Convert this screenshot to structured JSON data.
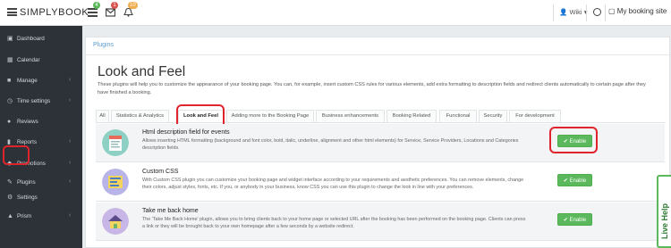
{
  "brand": "SIMPLYBOOK",
  "topbar": {
    "badges": [
      "4",
      "1",
      "10"
    ],
    "user": "Wiki",
    "booking_site": "My booking site"
  },
  "sidebar": {
    "items": [
      {
        "label": "Dashboard",
        "icon": "dashboard-icon",
        "arrow": ""
      },
      {
        "label": "Calendar",
        "icon": "calendar-icon",
        "arrow": ""
      },
      {
        "label": "Manage",
        "icon": "manage-icon",
        "arrow": "‹"
      },
      {
        "label": "Time settings",
        "icon": "clock-icon",
        "arrow": "‹"
      },
      {
        "label": "Reviews",
        "icon": "reviews-icon",
        "arrow": ""
      },
      {
        "label": "Reports",
        "icon": "reports-icon",
        "arrow": "‹"
      },
      {
        "label": "Promotions",
        "icon": "promotions-icon",
        "arrow": "‹"
      },
      {
        "label": "Plugins",
        "icon": "plugins-icon",
        "arrow": "‹"
      },
      {
        "label": "Settings",
        "icon": "settings-icon",
        "arrow": ""
      },
      {
        "label": "Prism",
        "icon": "prism-icon",
        "arrow": "‹"
      }
    ]
  },
  "main": {
    "breadcrumb": "Plugins",
    "title": "Look and Feel",
    "description": "These plugins will help you to customize the appearance of your booking page. You can, for example, insert custom CSS rules for various elements, add extra formatting to description fields and redirect clients automatically to certain page after they have finished a booking.",
    "tabs": [
      {
        "label": "All"
      },
      {
        "label": "Statistics & Analytics"
      },
      {
        "label": "Look and Feel"
      },
      {
        "label": "Adding more to the Booking Page"
      },
      {
        "label": "Business enhancements"
      },
      {
        "label": "Booking Related"
      },
      {
        "label": "Functional"
      },
      {
        "label": "Security"
      },
      {
        "label": "For development"
      }
    ],
    "plugins": [
      {
        "name": "Html description field for events",
        "description": "Allows inserting HTML formatting (background and font color, bold, italic, underline, alignment and other html elements) for Service, Service Providers, Locations and Categories description fields.",
        "button": "Enable"
      },
      {
        "name": "Custom CSS",
        "description": "With Custom CSS plugin you can customize your booking page and widget interface according to your requirements and aesthetic preferences. You can remove elements, change their colors, adjust styles, fonts, etc. If you, or anybody in your business, know CSS you can use this plugin to change the look in line with your preferences.",
        "button": "Enable"
      },
      {
        "name": "Take me back home",
        "description": "The 'Take Me Back Home' plugin, allows you to bring clients back to your home page or selected URL after the booking has been performed on the booking page. Clients can press a link or they will be brought back to your own homepage after a few seconds by a website redirect.",
        "button": "Enable"
      }
    ]
  },
  "live_help": "Live Help",
  "colors": {
    "accent": "#5cb85c",
    "highlight": "#e0242c",
    "sidebar": "#2c3238",
    "link": "#5b9bd1"
  }
}
